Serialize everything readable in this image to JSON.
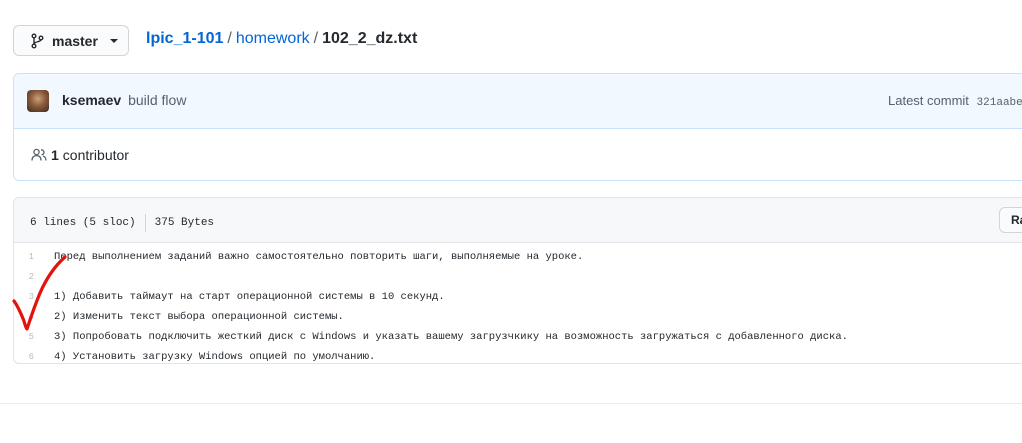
{
  "branch": {
    "label": "master",
    "icon": "git-branch-icon"
  },
  "breadcrumb": {
    "repo": "lpic_1-101",
    "separator": "/",
    "folder": "homework",
    "file": "102_2_dz.txt"
  },
  "commit": {
    "author": "ksemaev",
    "message": "build flow",
    "latest_label": "Latest commit",
    "sha": "321aabe"
  },
  "contributors": {
    "count": "1",
    "label": "contributor",
    "icon": "people-icon"
  },
  "file": {
    "lines_info": "6 lines (5 sloc)",
    "size": "375 Bytes",
    "raw_label": "Ra"
  },
  "code": {
    "lines": [
      {
        "num": "1",
        "text": "Перед выполнением заданий важно самостоятельно повторить шаги, выполняемые на уроке."
      },
      {
        "num": "2",
        "text": ""
      },
      {
        "num": "3",
        "text": "1) Добавить таймаут на старт операционной системы в 10 секунд."
      },
      {
        "num": "4",
        "text": "2) Изменить текст выбора операционной системы."
      },
      {
        "num": "5",
        "text": "3) Попробовать подключить жесткий диск с Windows и указать вашему загрузчкику на возможность загружаться с добавленного диска."
      },
      {
        "num": "6",
        "text": "4) Установить загрузку Windows опцией по умолчанию."
      }
    ]
  },
  "colors": {
    "link": "#0366d6",
    "commit_bg": "#f1f8ff",
    "checkmark": "#e3120b"
  }
}
